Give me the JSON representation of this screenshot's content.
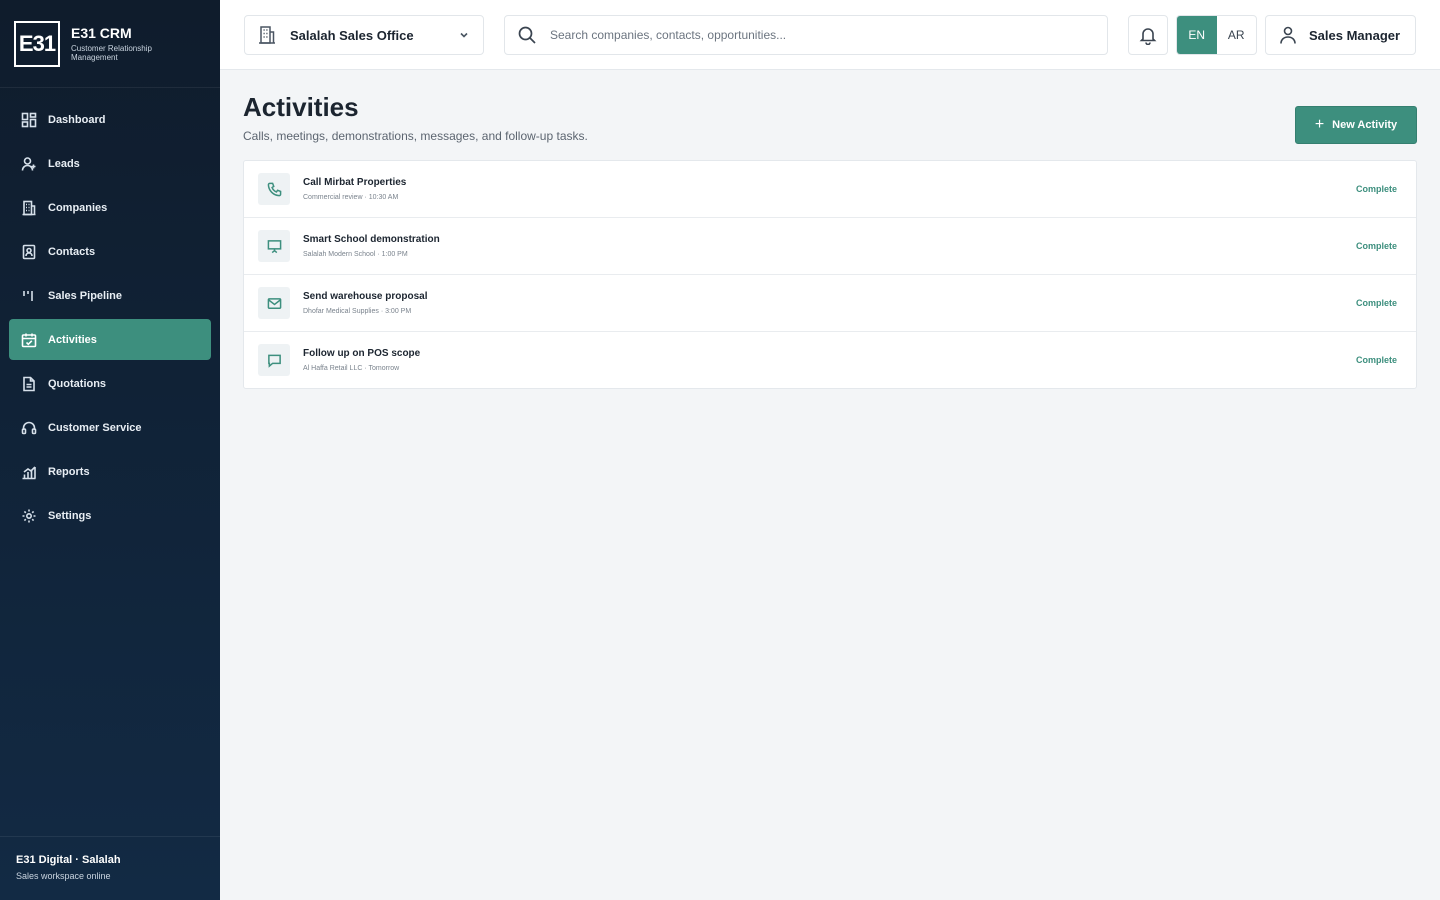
{
  "brand": {
    "logo": "E31",
    "name": "E31 CRM",
    "subtitle": "Customer Relationship Management"
  },
  "sidebar": {
    "items": [
      {
        "label": "Dashboard",
        "icon": "dashboard-icon"
      },
      {
        "label": "Leads",
        "icon": "user-add-icon"
      },
      {
        "label": "Companies",
        "icon": "building-icon"
      },
      {
        "label": "Contacts",
        "icon": "contact-card-icon"
      },
      {
        "label": "Sales Pipeline",
        "icon": "pipeline-icon"
      },
      {
        "label": "Activities",
        "icon": "calendar-check-icon",
        "active": true
      },
      {
        "label": "Quotations",
        "icon": "document-icon"
      },
      {
        "label": "Customer Service",
        "icon": "headset-icon"
      },
      {
        "label": "Reports",
        "icon": "chart-icon"
      },
      {
        "label": "Settings",
        "icon": "gear-icon"
      }
    ],
    "footer": {
      "org": "E31 Digital · Salalah",
      "status": "Sales workspace online"
    }
  },
  "topbar": {
    "office": "Salalah Sales Office",
    "search_placeholder": "Search companies, contacts, opportunities...",
    "lang_en": "EN",
    "lang_ar": "AR",
    "user_role": "Sales Manager"
  },
  "main": {
    "title": "Activities",
    "subtitle": "Calls, meetings, demonstrations, messages, and follow-up tasks.",
    "new_button": "New Activity",
    "activities": [
      {
        "title": "Call Mirbat Properties",
        "meta": "Commercial review · 10:30 AM",
        "icon": "phone-icon",
        "action": "Complete"
      },
      {
        "title": "Smart School demonstration",
        "meta": "Salalah Modern School · 1:00 PM",
        "icon": "presentation-icon",
        "action": "Complete"
      },
      {
        "title": "Send warehouse proposal",
        "meta": "Dhofar Medical Supplies · 3:00 PM",
        "icon": "mail-icon",
        "action": "Complete"
      },
      {
        "title": "Follow up on POS scope",
        "meta": "Al Haffa Retail LLC · Tomorrow",
        "icon": "chat-icon",
        "action": "Complete"
      }
    ]
  },
  "colors": {
    "accent": "#3d8f7e",
    "sidebar_bg": "#0f1c2c",
    "page_bg": "#f3f5f7"
  }
}
